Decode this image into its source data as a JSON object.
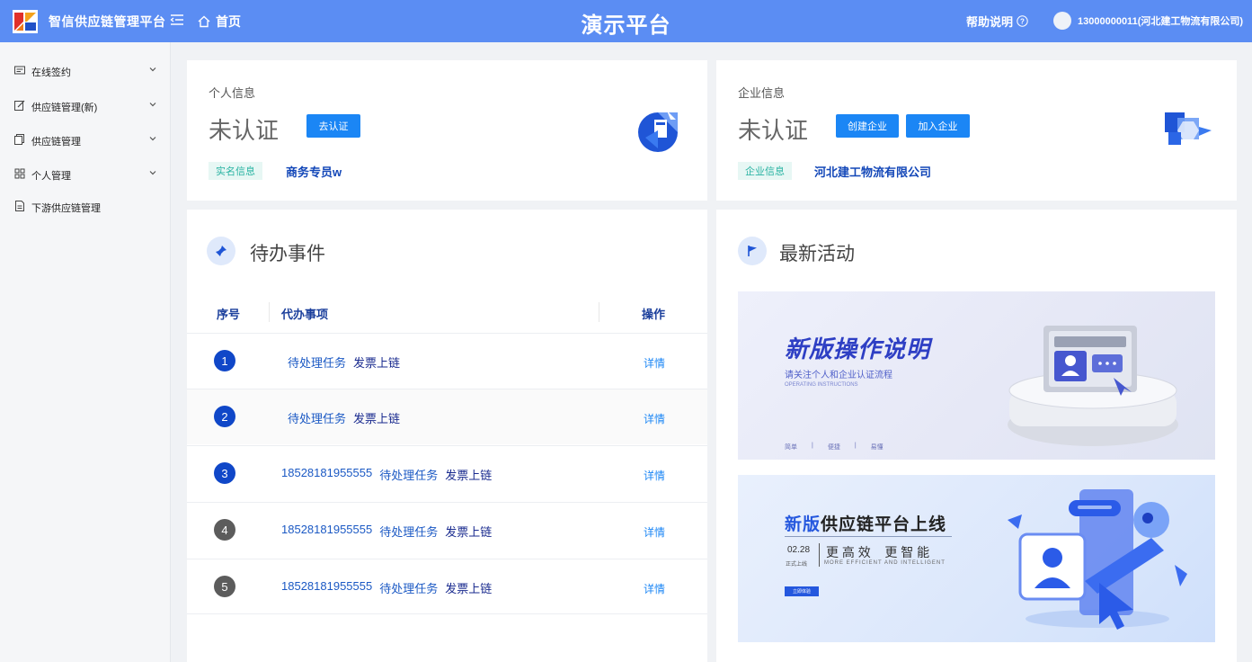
{
  "header": {
    "app_title": "智信供应链管理平台",
    "home_label": "首页",
    "center_title": "演示平台",
    "help_label": "帮助说明",
    "user_label": "13000000011(河北建工物流有限公司)"
  },
  "sidebar": {
    "items": [
      {
        "label": "在线签约",
        "icon": "contract-icon",
        "expandable": true
      },
      {
        "label": "供应链管理(新)",
        "icon": "edit-icon",
        "expandable": true
      },
      {
        "label": "供应链管理",
        "icon": "copy-icon",
        "expandable": true
      },
      {
        "label": "个人管理",
        "icon": "grid-icon",
        "expandable": true
      },
      {
        "label": "下游供应链管理",
        "icon": "document-icon",
        "expandable": false
      }
    ]
  },
  "personal": {
    "title": "个人信息",
    "status": "未认证",
    "button": "去认证",
    "tag": "实名信息",
    "value": "商务专员w"
  },
  "enterprise": {
    "title": "企业信息",
    "status": "未认证",
    "button_create": "创建企业",
    "button_join": "加入企业",
    "tag": "企业信息",
    "value": "河北建工物流有限公司"
  },
  "todo": {
    "title": "待办事件",
    "columns": {
      "index": "序号",
      "item": "代办事项",
      "action": "操作"
    },
    "rows": [
      {
        "index": "1",
        "phone": "",
        "task": "待处理任务",
        "type": "发票上链",
        "action": "详情",
        "badge_color": "#1047c8"
      },
      {
        "index": "2",
        "phone": "",
        "task": "待处理任务",
        "type": "发票上链",
        "action": "详情",
        "badge_color": "#1047c8"
      },
      {
        "index": "3",
        "phone": "18528181955555",
        "task": "待处理任务",
        "type": "发票上链",
        "action": "详情",
        "badge_color": "#1047c8"
      },
      {
        "index": "4",
        "phone": "18528181955555",
        "task": "待处理任务",
        "type": "发票上链",
        "action": "详情",
        "badge_color": "#5c5c5c"
      },
      {
        "index": "5",
        "phone": "18528181955555",
        "task": "待处理任务",
        "type": "发票上链",
        "action": "详情",
        "badge_color": "#5c5c5c"
      }
    ]
  },
  "activity": {
    "title": "最新活动",
    "banner1": {
      "title": "新版操作说明",
      "subtitle": "请关注个人和企业认证流程",
      "subtitle_en": "OPERATING INSTRUCTIONS",
      "footer": [
        "简单",
        "便捷",
        "易懂"
      ]
    },
    "banner2": {
      "title_part1": "新版",
      "title_part2": "供应链平台上线",
      "date": "02.28",
      "date_sub": "正式上线",
      "slogan": "更 高 效    更 智 能",
      "slogan_en": "MORE EFFICIENT AND INTELLIGENT",
      "button": "立即体验"
    }
  },
  "colors": {
    "header_bg": "#5b8df3",
    "primary_button": "#1b86f5",
    "tag_bg": "#e7f7f4",
    "tag_text": "#28b3a2",
    "link_dark": "#1347b8"
  }
}
